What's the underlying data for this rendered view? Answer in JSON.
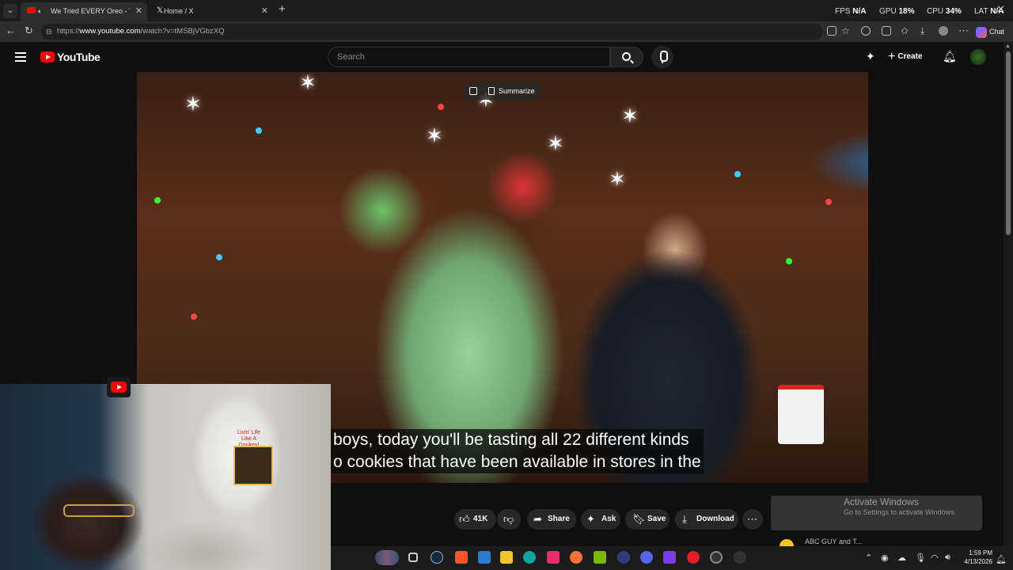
{
  "browser": {
    "tabs": [
      {
        "title": "We Tried EVERY Oreo - YouTu",
        "active": true,
        "favicon": "youtube-icon"
      },
      {
        "title": "Home / X",
        "active": false,
        "favicon": "x-icon"
      }
    ],
    "url_prefix": "https://",
    "url_host": "www.youtube.com",
    "url_path": "/watch?v=tMSBjVGbzXQ",
    "copilot_label": "Chat"
  },
  "perf_overlay": {
    "fps_label": "FPS",
    "fps_value": "N/A",
    "gpu_label": "GPU",
    "gpu_value": "18",
    "cpu_label": "CPU",
    "cpu_value": "34",
    "lat_label": "LAT",
    "lat_value": "N/A",
    "unit": "%"
  },
  "youtube": {
    "logo_text": "YouTube",
    "search_placeholder": "Search",
    "create_label": "Create"
  },
  "player": {
    "summarize_label": "Summarize",
    "caption_line1": "boys, today you'll be tasting all 22 different kinds",
    "caption_line2": "o cookies that have been available in stores in the"
  },
  "actions": {
    "like_count": "41K",
    "share_label": "Share",
    "ask_label": "Ask",
    "save_label": "Save",
    "download_label": "Download"
  },
  "windows_watermark": {
    "line1": "Activate Windows",
    "line2": "Go to Settings to activate Windows."
  },
  "next_item_text": "ABC GUY and T...",
  "taskbar": {
    "time": "1:59 PM",
    "date": "4/13/2026"
  },
  "colors": {
    "youtube_red": "#ff0000",
    "page_bg": "#0f0f0f",
    "pill_bg": "#272727"
  }
}
